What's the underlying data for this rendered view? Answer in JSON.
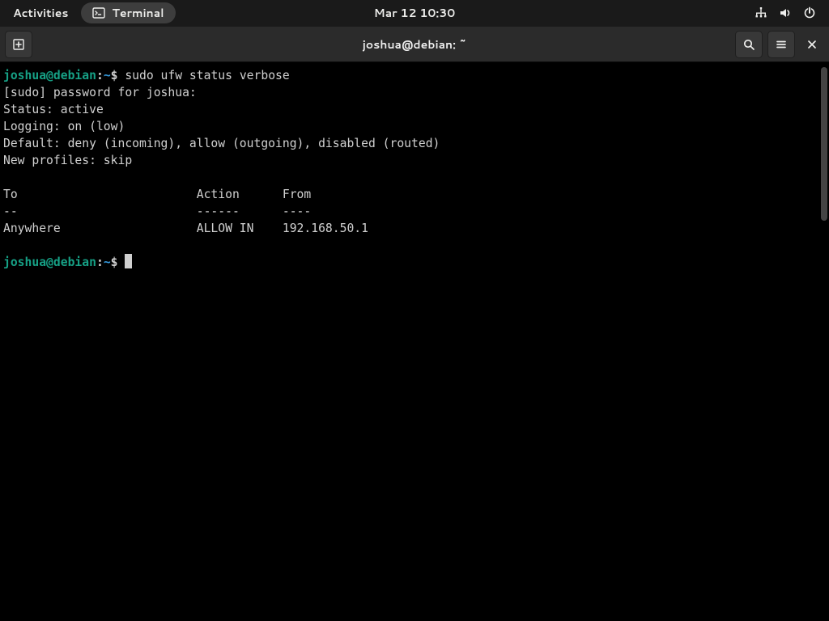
{
  "topbar": {
    "activities": "Activities",
    "app_name": "Terminal",
    "datetime": "Mar 12  10:30"
  },
  "headerbar": {
    "title": "joshua@debian: ~"
  },
  "terminal": {
    "prompt": {
      "user_host": "joshua@debian",
      "colon": ":",
      "path": "~",
      "symbol": "$"
    },
    "command": "sudo ufw status verbose",
    "output_lines": [
      "[sudo] password for joshua:",
      "Status: active",
      "Logging: on (low)",
      "Default: deny (incoming), allow (outgoing), disabled (routed)",
      "New profiles: skip",
      "",
      "To                         Action      From",
      "--                         ------      ----",
      "Anywhere                   ALLOW IN    192.168.50.1"
    ]
  }
}
